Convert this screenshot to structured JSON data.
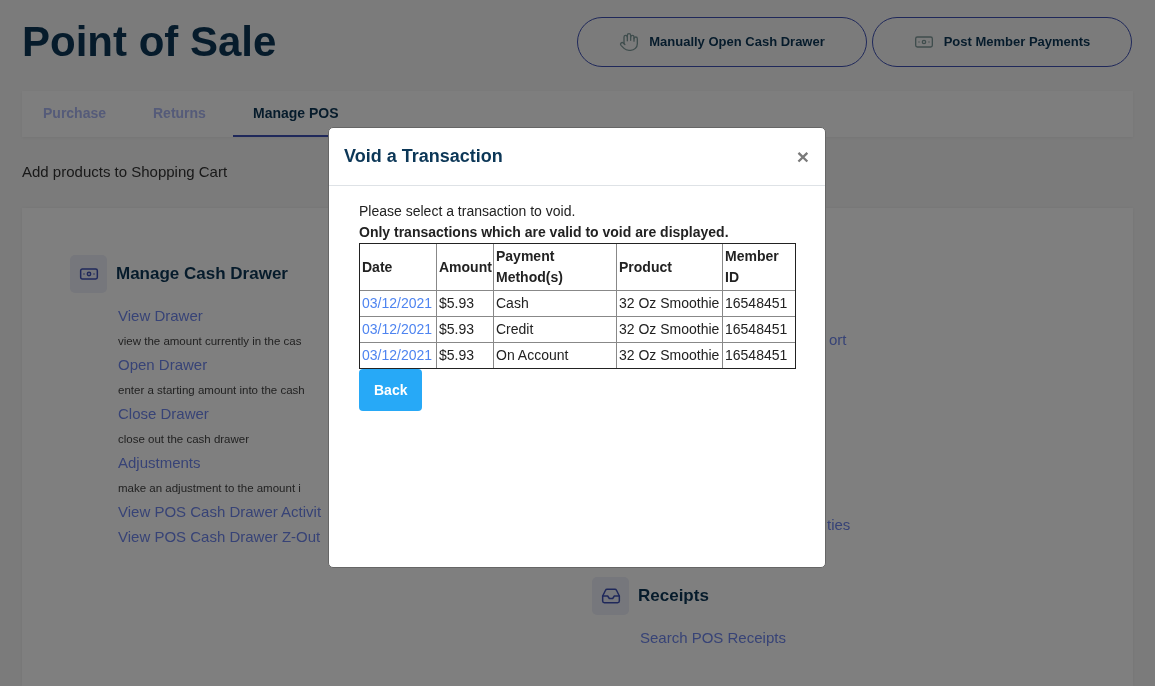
{
  "page": {
    "title": "Point of Sale"
  },
  "header_buttons": [
    {
      "label": "Manually Open Cash Drawer"
    },
    {
      "label": "Post Member Payments"
    }
  ],
  "tabs": [
    {
      "label": "Purchase",
      "selected": false
    },
    {
      "label": "Returns",
      "selected": false
    },
    {
      "label": "Manage POS",
      "selected": true
    }
  ],
  "subtitle": "Add products to Shopping Cart",
  "left_section": {
    "heading": "Manage Cash Drawer",
    "items": [
      {
        "kind": "link",
        "text": "View Drawer"
      },
      {
        "kind": "description",
        "text": "view the amount currently in the cas"
      },
      {
        "kind": "link",
        "text": "Open Drawer"
      },
      {
        "kind": "description",
        "text": "enter a starting amount into the cash"
      },
      {
        "kind": "link",
        "text": "Close Drawer"
      },
      {
        "kind": "description",
        "text": "close out the cash drawer"
      },
      {
        "kind": "link",
        "text": "Adjustments"
      },
      {
        "kind": "description",
        "text": "make an adjustment to the amount i"
      },
      {
        "kind": "link",
        "text": "View POS Cash Drawer Activit"
      },
      {
        "kind": "link",
        "text": "View POS Cash Drawer Z-Out"
      }
    ]
  },
  "right_section": {
    "partial_links": [
      "ort",
      "ties"
    ],
    "heading": "Receipts",
    "items": [
      {
        "kind": "link",
        "text": "Search POS Receipts"
      }
    ]
  },
  "modal": {
    "title": "Void a Transaction",
    "close": "×",
    "instruction": "Please select a transaction to void.",
    "note": "Only transactions which are valid to void are displayed.",
    "table": {
      "columns": [
        "Date",
        "Amount",
        "Payment Method(s)",
        "Product",
        "Member ID"
      ],
      "rows": [
        [
          "03/12/2021",
          "$5.93",
          "Cash",
          "32 Oz Smoothie",
          "16548451"
        ],
        [
          "03/12/2021",
          "$5.93",
          "Credit",
          "32 Oz Smoothie",
          "16548451"
        ],
        [
          "03/12/2021",
          "$5.93",
          "On Account",
          "32 Oz Smoothie",
          "16548451"
        ]
      ]
    },
    "buttons": [
      "Back"
    ]
  }
}
